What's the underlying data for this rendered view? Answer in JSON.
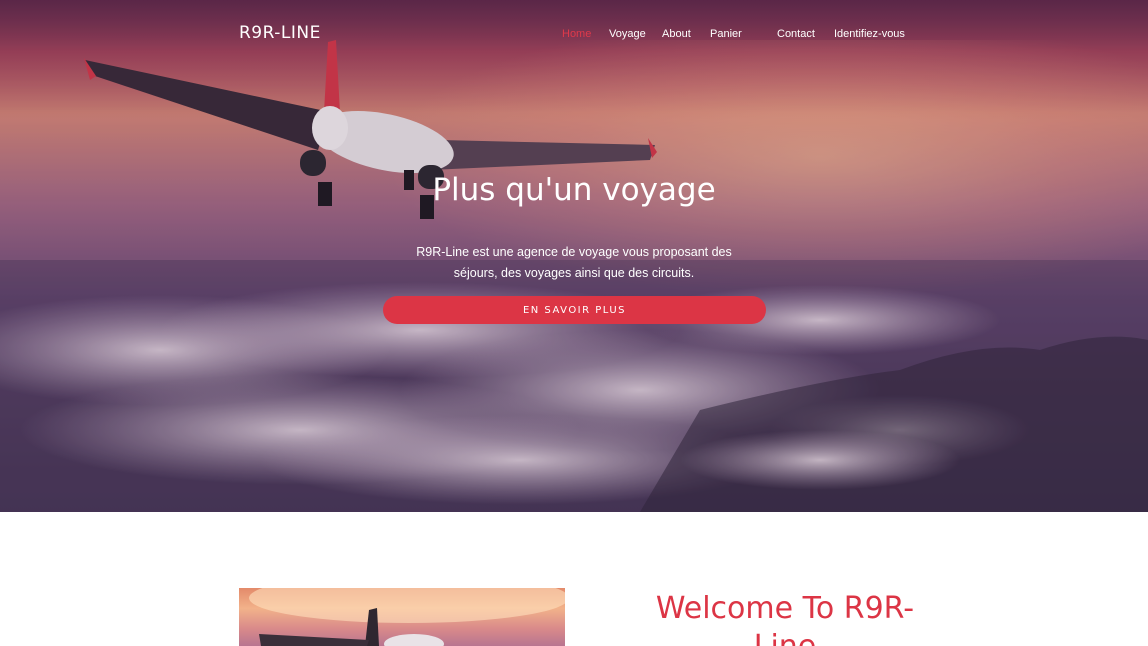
{
  "navbar": {
    "brand": "R9R-LINE",
    "links": [
      {
        "label": "Home",
        "active": true
      },
      {
        "label": "Voyage",
        "active": false
      },
      {
        "label": "About",
        "active": false
      },
      {
        "label": "Panier",
        "active": false
      },
      {
        "label": "Contact",
        "active": false
      },
      {
        "label": "Identifiez-vous",
        "active": false
      }
    ]
  },
  "hero": {
    "title": "Plus qu'un voyage",
    "description": "R9R-Line est une agence de voyage vous proposant des séjours, des voyages ainsi que des circuits.",
    "cta_label": "EN SAVOIR PLUS",
    "background_image": "airplane-above-clouds-at-sunset"
  },
  "about": {
    "image": "airplane-sunset-photo",
    "welcome_title": "Welcome To R9R-Line"
  },
  "colors": {
    "accent": "#dc3545",
    "nav_text": "#ffffff",
    "page_background": "#ffffff"
  }
}
